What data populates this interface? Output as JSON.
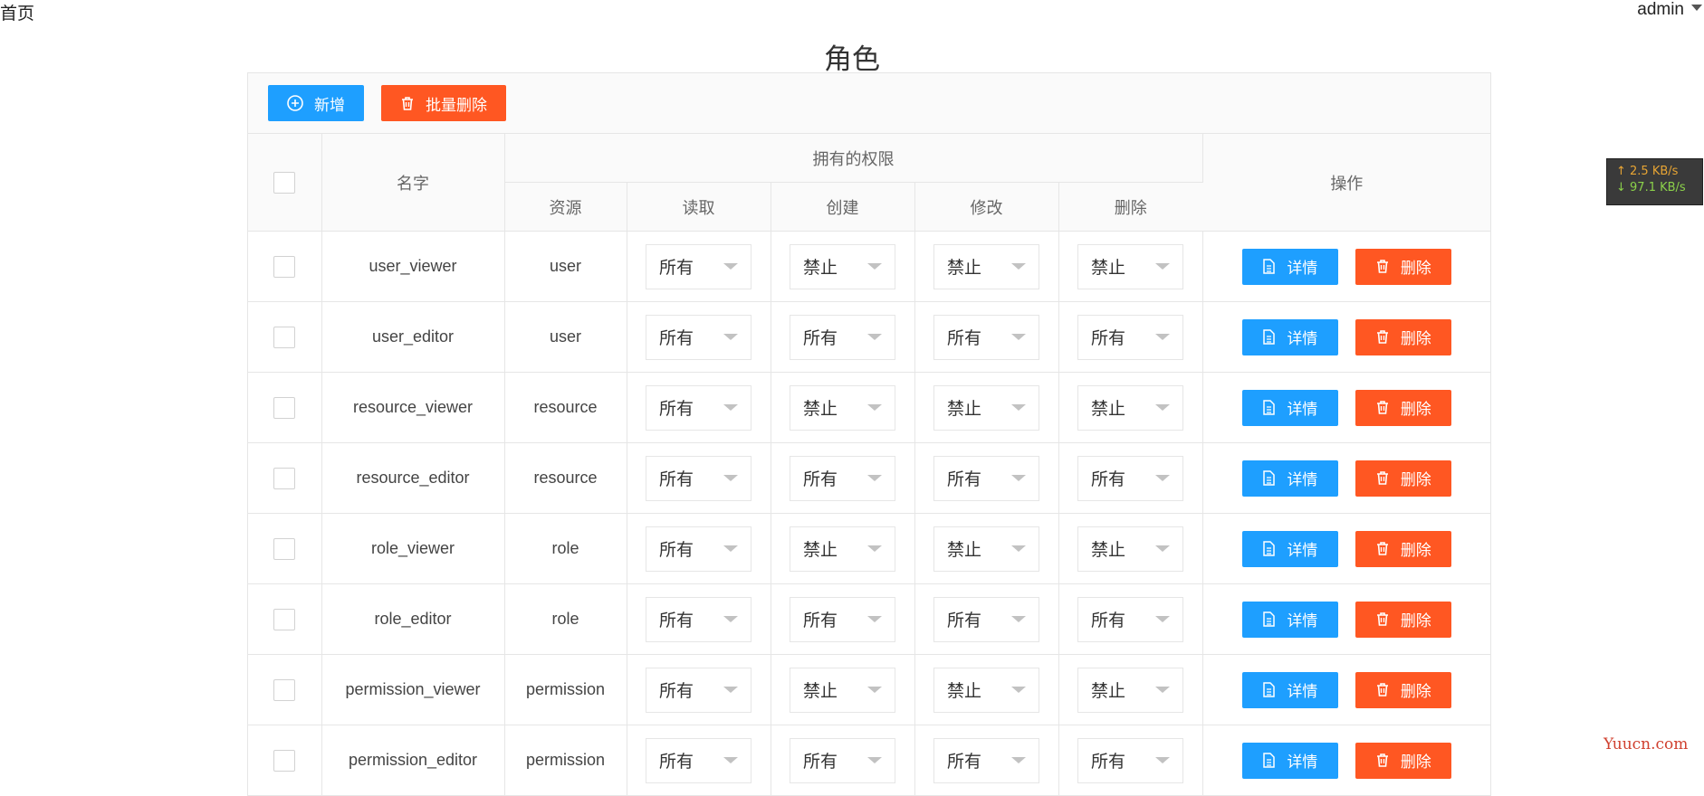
{
  "nav": {
    "home": "首页",
    "user": "admin"
  },
  "title": "角色",
  "toolbar": {
    "add_label": "新增",
    "batch_delete_label": "批量删除"
  },
  "table": {
    "headers": {
      "name": "名字",
      "permissions_group": "拥有的权限",
      "resource": "资源",
      "read": "读取",
      "create": "创建",
      "update": "修改",
      "delete": "删除",
      "actions": "操作"
    },
    "detail_label": "详情",
    "delete_label": "删除",
    "rows": [
      {
        "name": "user_viewer",
        "resource": "user",
        "read": "所有",
        "create": "禁止",
        "update": "禁止",
        "delete": "禁止"
      },
      {
        "name": "user_editor",
        "resource": "user",
        "read": "所有",
        "create": "所有",
        "update": "所有",
        "delete": "所有"
      },
      {
        "name": "resource_viewer",
        "resource": "resource",
        "read": "所有",
        "create": "禁止",
        "update": "禁止",
        "delete": "禁止"
      },
      {
        "name": "resource_editor",
        "resource": "resource",
        "read": "所有",
        "create": "所有",
        "update": "所有",
        "delete": "所有"
      },
      {
        "name": "role_viewer",
        "resource": "role",
        "read": "所有",
        "create": "禁止",
        "update": "禁止",
        "delete": "禁止"
      },
      {
        "name": "role_editor",
        "resource": "role",
        "read": "所有",
        "create": "所有",
        "update": "所有",
        "delete": "所有"
      },
      {
        "name": "permission_viewer",
        "resource": "permission",
        "read": "所有",
        "create": "禁止",
        "update": "禁止",
        "delete": "禁止"
      },
      {
        "name": "permission_editor",
        "resource": "permission",
        "read": "所有",
        "create": "所有",
        "update": "所有",
        "delete": "所有"
      }
    ]
  },
  "netspeed": {
    "up": "2.5 KB/s",
    "down": "97.1 KB/s"
  },
  "watermark": "Yuucn.com",
  "colors": {
    "primary": "#1e9fff",
    "danger": "#ff5722"
  },
  "icons": {
    "add": "plus-circle-icon",
    "batch_delete": "trash-icon",
    "detail": "file-icon",
    "delete": "trash-icon",
    "dropdown": "triangle-down-icon"
  }
}
